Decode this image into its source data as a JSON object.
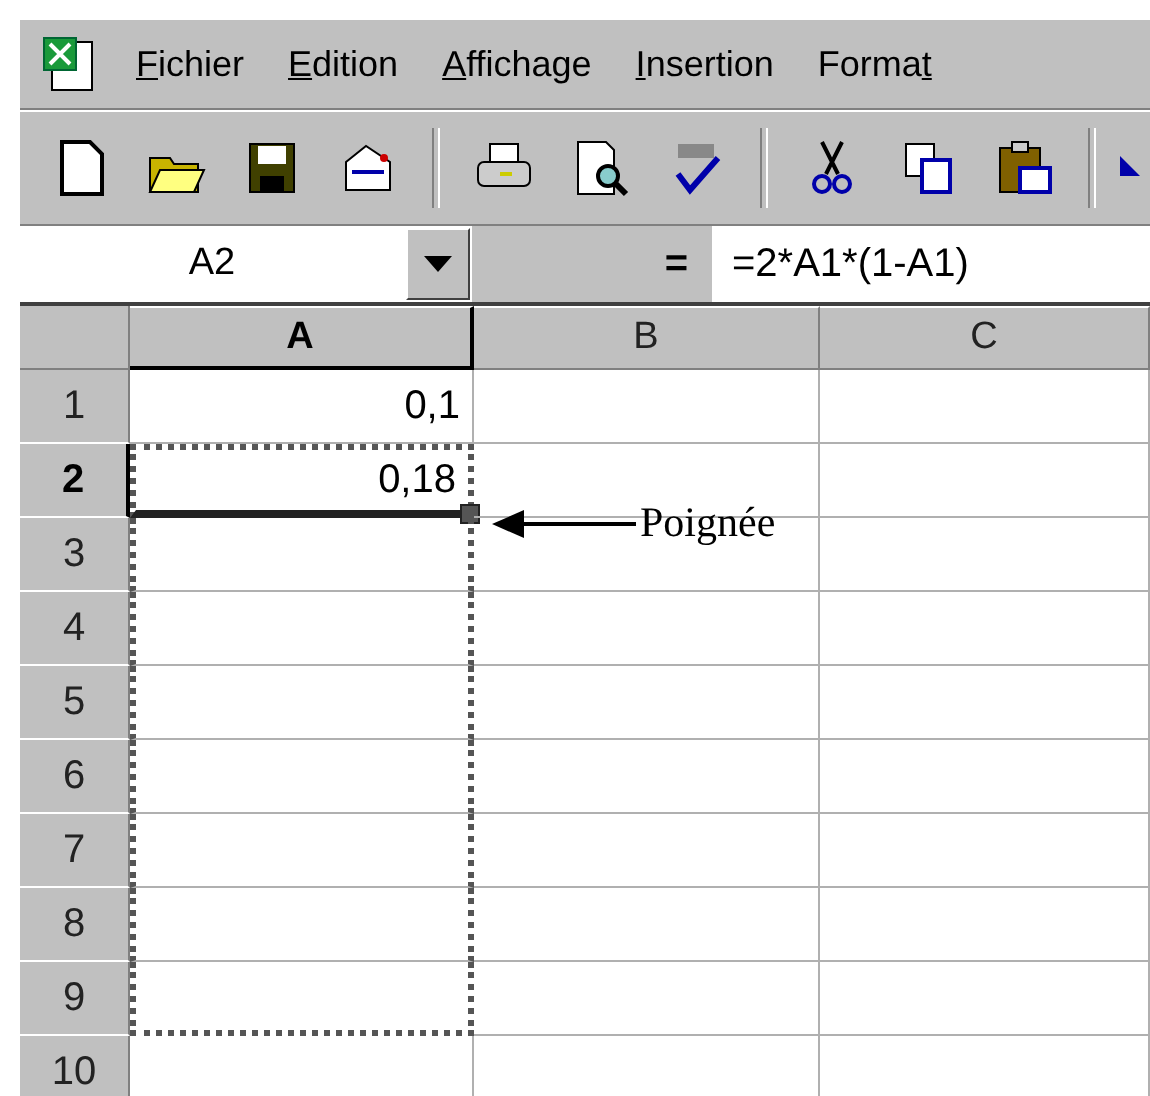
{
  "menu": [
    {
      "key": "F",
      "post": "ichier"
    },
    {
      "key": "E",
      "post": "dition"
    },
    {
      "key": "A",
      "post": "ffichage"
    },
    {
      "key": "I",
      "post": "nsertion"
    },
    {
      "pre": "Forma",
      "key": "t"
    }
  ],
  "formula_bar": {
    "name_box": "A2",
    "equals": "=",
    "formula": "=2*A1*(1-A1)"
  },
  "columns": [
    {
      "label": "A",
      "selected": true
    },
    {
      "label": "B",
      "selected": false
    },
    {
      "label": "C",
      "selected": false
    }
  ],
  "rows": [
    {
      "number": "1",
      "selected": false,
      "cells": [
        {
          "value": "0,1",
          "selected": false,
          "marked": false
        },
        {
          "selected": false,
          "marked": false
        },
        {
          "selected": false,
          "marked": false
        }
      ]
    },
    {
      "number": "2",
      "selected": true,
      "cells": [
        {
          "value": "0,18",
          "selected": true,
          "marked": true
        },
        {
          "selected": false,
          "marked": false
        },
        {
          "selected": false,
          "marked": false
        }
      ]
    },
    {
      "number": "3",
      "selected": false,
      "cells": [
        {
          "selected": false,
          "marked": true
        },
        {
          "selected": false,
          "marked": false
        },
        {
          "selected": false,
          "marked": false
        }
      ]
    },
    {
      "number": "4",
      "selected": false,
      "cells": [
        {
          "selected": false,
          "marked": true
        },
        {
          "selected": false,
          "marked": false
        },
        {
          "selected": false,
          "marked": false
        }
      ]
    },
    {
      "number": "5",
      "selected": false,
      "cells": [
        {
          "selected": false,
          "marked": true
        },
        {
          "selected": false,
          "marked": false
        },
        {
          "selected": false,
          "marked": false
        }
      ]
    },
    {
      "number": "6",
      "selected": false,
      "cells": [
        {
          "selected": false,
          "marked": true
        },
        {
          "selected": false,
          "marked": false
        },
        {
          "selected": false,
          "marked": false
        }
      ]
    },
    {
      "number": "7",
      "selected": false,
      "cells": [
        {
          "selected": false,
          "marked": true
        },
        {
          "selected": false,
          "marked": false
        },
        {
          "selected": false,
          "marked": false
        }
      ]
    },
    {
      "number": "8",
      "selected": false,
      "cells": [
        {
          "selected": false,
          "marked": true
        },
        {
          "selected": false,
          "marked": false
        },
        {
          "selected": false,
          "marked": false
        }
      ]
    },
    {
      "number": "9",
      "selected": false,
      "cells": [
        {
          "selected": false,
          "marked": true
        },
        {
          "selected": false,
          "marked": false
        },
        {
          "selected": false,
          "marked": false
        }
      ]
    },
    {
      "number": "10",
      "selected": false,
      "cells": [
        {
          "selected": false,
          "marked": false
        },
        {
          "selected": false,
          "marked": false
        },
        {
          "selected": false,
          "marked": false
        }
      ]
    }
  ],
  "annotation": {
    "label": "Poignée"
  }
}
